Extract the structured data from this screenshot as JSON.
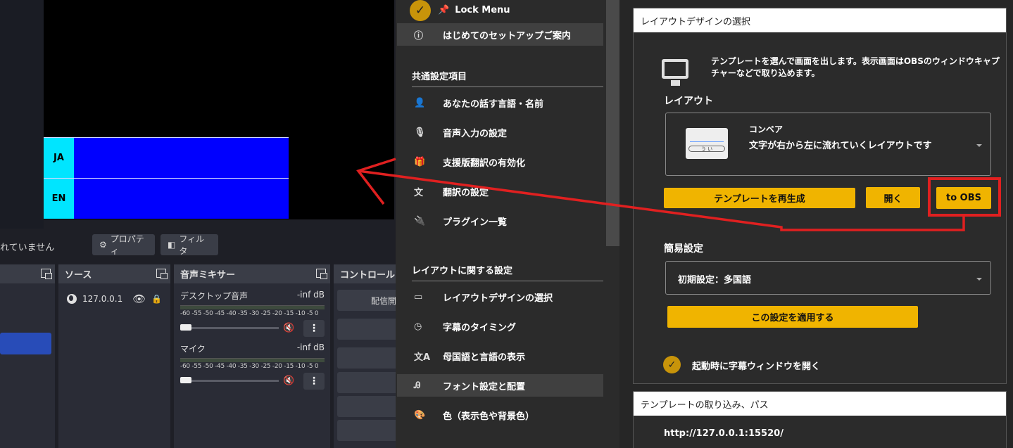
{
  "preview": {
    "rows": [
      {
        "lang": "JA"
      },
      {
        "lang": "EN"
      }
    ]
  },
  "obs": {
    "no_source_text": "れていません",
    "properties_label": "プロパティ",
    "filters_label": "フィルタ",
    "docks": {
      "sources_title": "ソース",
      "mixer_title": "音声ミキサー",
      "controls_title": "コントロール"
    },
    "source_item": "127.0.0.1",
    "mixer": [
      {
        "name": "デスクトップ音声",
        "level": "-inf dB"
      },
      {
        "name": "マイク",
        "level": "-inf dB"
      }
    ],
    "meter_scale": "-60 -55 -50 -45 -40 -35 -30 -25 -20 -15 -10 -5 0",
    "controls_first": "配信開始"
  },
  "sidebar": {
    "lock_menu": "Lock Menu",
    "setup_guide": "はじめてのセットアップご案内",
    "section_common": "共通設定項目",
    "common_items": [
      {
        "label": "あなたの話す言語・名前",
        "icon": "speaker-person-icon"
      },
      {
        "label": "音声入力の設定",
        "icon": "mic-icon"
      },
      {
        "label": "支援版翻訳の有効化",
        "icon": "gift-icon"
      },
      {
        "label": "翻訳の設定",
        "icon": "translate-icon"
      },
      {
        "label": "プラグイン一覧",
        "icon": "plug-icon"
      }
    ],
    "section_layout": "レイアウトに関する設定",
    "layout_items": [
      {
        "label": "レイアウトデザインの選択",
        "icon": "layout-icon"
      },
      {
        "label": "字幕のタイミング",
        "icon": "clock-icon"
      },
      {
        "label": "母国語と言語の表示",
        "icon": "language-icon"
      },
      {
        "label": "フォント設定と配置",
        "icon": "font-icon"
      },
      {
        "label": "色（表示色や背景色）",
        "icon": "palette-icon"
      }
    ]
  },
  "panel": {
    "title": "レイアウトデザインの選択",
    "description": "テンプレートを選んで画面を出します。表示画面はOBSのウィンドウキャプチャーなどで取り込めます。",
    "layout_label": "レイアウト",
    "layout_name": "コンベア",
    "layout_desc": "文字が右から左に流れていくレイアウトです",
    "thumb_text": "う い",
    "regenerate_button": "テンプレートを再生成",
    "open_button": "開く",
    "to_obs_button": "to OBS",
    "quick_label": "簡易設定",
    "quick_value": "初期設定：多国語",
    "apply_button": "この設定を適用する",
    "startup_checkbox": "起動時に字幕ウィンドウを開く",
    "import_title": "テンプレートの取り込み、パス",
    "url": "http://127.0.0.1:15520/"
  },
  "colors": {
    "accent": "#f0b400",
    "annotation": "#e02020",
    "subtitle_label": "#00e5ff",
    "subtitle_bar": "#0000ff"
  }
}
